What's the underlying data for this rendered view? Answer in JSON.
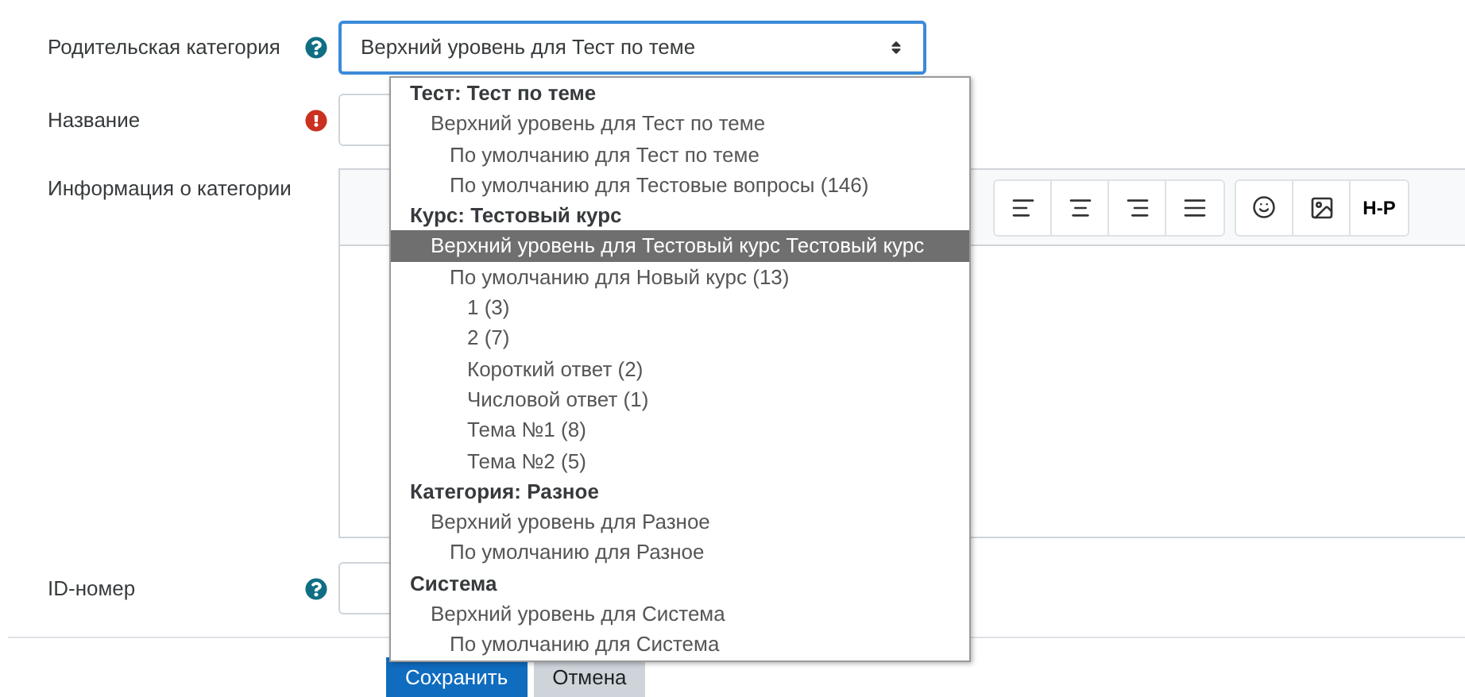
{
  "form": {
    "parent_category": {
      "label": "Родительская категория",
      "value": "Верхний уровень для Тест по теме"
    },
    "name": {
      "label": "Название"
    },
    "info": {
      "label": "Информация о категории",
      "toolbar_logo": "H-P"
    },
    "idnumber": {
      "label": "ID-номер"
    }
  },
  "dropdown": [
    {
      "text": "Тест: Тест по теме",
      "selected": false,
      "children": [
        {
          "text": "Верхний уровень для Тест по теме",
          "selected": false,
          "children": [
            {
              "text": "По умолчанию для Тест по теме",
              "selected": false
            },
            {
              "text": "По умолчанию для Тестовые вопросы (146)",
              "selected": false
            }
          ]
        }
      ]
    },
    {
      "text": "Курс: Тестовый курс",
      "selected": false,
      "children": [
        {
          "text": "Верхний уровень для Тестовый курс Тестовый курс",
          "selected": true,
          "children": [
            {
              "text": "По умолчанию для Новый курс (13)",
              "selected": false,
              "children": [
                {
                  "text": "1 (3)",
                  "selected": false
                },
                {
                  "text": "2 (7)",
                  "selected": false
                },
                {
                  "text": "Короткий ответ (2)",
                  "selected": false
                },
                {
                  "text": "Числовой ответ (1)",
                  "selected": false
                },
                {
                  "text": "Тема №1 (8)",
                  "selected": false
                },
                {
                  "text": "Тема №2 (5)",
                  "selected": false
                }
              ]
            }
          ]
        }
      ]
    },
    {
      "text": "Категория: Разное",
      "selected": false,
      "children": [
        {
          "text": "Верхний уровень для Разное",
          "selected": false,
          "children": [
            {
              "text": "По умолчанию для Разное",
              "selected": false
            }
          ]
        }
      ]
    },
    {
      "text": "Система",
      "selected": false,
      "children": [
        {
          "text": "Верхний уровень для Система",
          "selected": false,
          "children": [
            {
              "text": "По умолчанию для Система",
              "selected": false
            }
          ]
        }
      ]
    }
  ],
  "buttons": [
    {
      "label": "Сохранить",
      "kind": "primary"
    },
    {
      "label": "Отмена",
      "kind": "secondary"
    }
  ]
}
